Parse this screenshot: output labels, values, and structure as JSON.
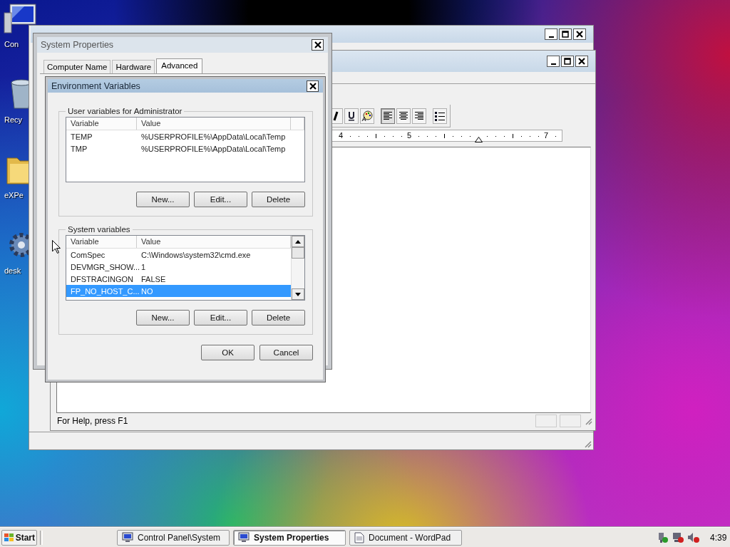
{
  "desktop_icons": [
    {
      "label": "Con",
      "kind": "computer"
    },
    {
      "label": "Recy",
      "kind": "bin"
    },
    {
      "label": "eXPe",
      "kind": "folder"
    },
    {
      "label": "desk",
      "kind": "gear"
    }
  ],
  "wordpad": {
    "toolbar": [
      {
        "buttons": [
          {
            "kind": "italic",
            "selected": false
          },
          {
            "kind": "underline",
            "selected": false
          },
          {
            "kind": "color",
            "selected": false
          }
        ]
      },
      {
        "buttons": [
          {
            "kind": "align-left",
            "selected": true
          },
          {
            "kind": "align-center",
            "selected": false
          },
          {
            "kind": "align-right",
            "selected": false
          }
        ]
      },
      {
        "buttons": [
          {
            "kind": "bullets",
            "selected": false
          }
        ]
      }
    ],
    "ruler": [
      {
        "kind": "number",
        "label": "4"
      },
      {
        "kind": "number",
        "label": "5"
      },
      {
        "kind": "indent"
      },
      {
        "kind": "number",
        "label": "7"
      }
    ],
    "status_bar": "For Help, press F1"
  },
  "system_properties": {
    "title": "System Properties",
    "tabs": [
      {
        "label": "Computer Name",
        "selected": false
      },
      {
        "label": "Hardware",
        "selected": false
      },
      {
        "label": "Advanced",
        "selected": true
      }
    ]
  },
  "environment_variables": {
    "title": "Environment Variables",
    "groups": [
      {
        "title": "User variables for Administrator",
        "columns": [
          "Variable",
          "Value"
        ],
        "scrollbar": false,
        "rows": [
          {
            "variable": "TEMP",
            "value": "%USERPROFILE%\\AppData\\Local\\Temp",
            "selected": false
          },
          {
            "variable": "TMP",
            "value": "%USERPROFILE%\\AppData\\Local\\Temp",
            "selected": false
          }
        ],
        "buttons": [
          "New...",
          "Edit...",
          "Delete"
        ]
      },
      {
        "title": "System variables",
        "columns": [
          "Variable",
          "Value"
        ],
        "scrollbar": true,
        "rows": [
          {
            "variable": "ComSpec",
            "value": "C:\\Windows\\system32\\cmd.exe",
            "selected": false
          },
          {
            "variable": "DEVMGR_SHOW...",
            "value": "1",
            "selected": false
          },
          {
            "variable": "DFSTRACINGON",
            "value": "FALSE",
            "selected": false
          },
          {
            "variable": "FP_NO_HOST_C...",
            "value": "NO",
            "selected": true
          }
        ],
        "buttons": [
          "New...",
          "Edit...",
          "Delete"
        ]
      }
    ],
    "buttons": [
      "OK",
      "Cancel"
    ]
  },
  "taskbar": {
    "start": "Start",
    "tasks": [
      {
        "label": "Control Panel\\System",
        "kind": "monitor",
        "selected": false
      },
      {
        "label": "System Properties",
        "kind": "monitor",
        "selected": true
      },
      {
        "label": "Document - WordPad",
        "kind": "document",
        "selected": false
      }
    ],
    "clock": "4:39"
  }
}
